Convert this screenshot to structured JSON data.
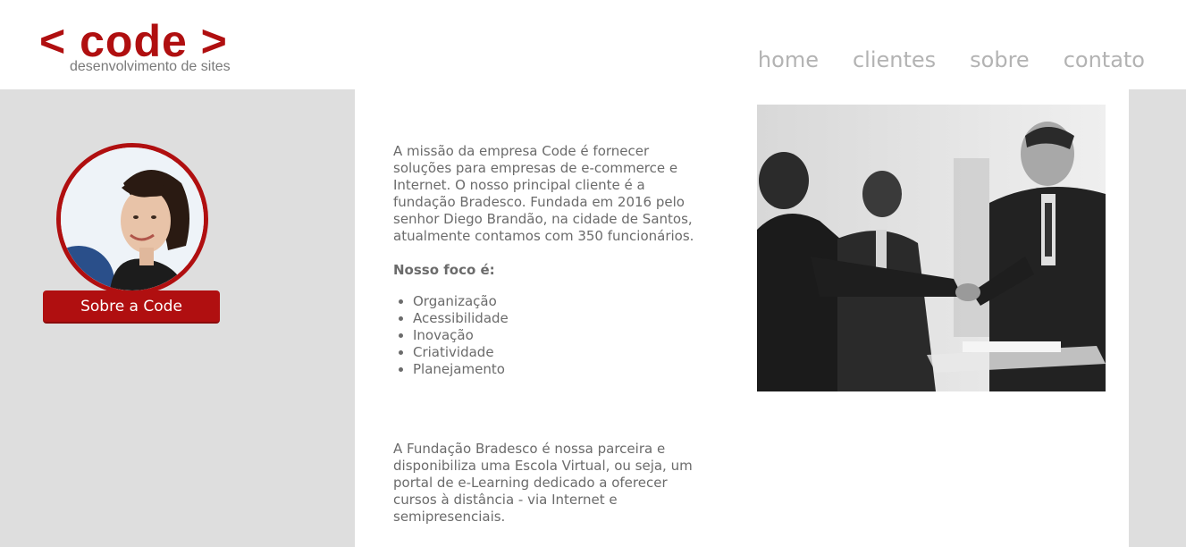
{
  "header": {
    "logo_main": "< code >",
    "logo_sub": "desenvolvimento de sites",
    "nav": [
      {
        "label": "home"
      },
      {
        "label": "clientes"
      },
      {
        "label": "sobre"
      },
      {
        "label": "contato"
      }
    ]
  },
  "sidebar": {
    "button_label": "Sobre a Code"
  },
  "main": {
    "intro": "A missão da empresa Code é fornecer soluções para empresas de e-commerce e Internet. O nosso principal cliente é a fundação Bradesco. Fundada em 2016 pelo senhor Diego Brandão, na cidade de Santos, atualmente contamos com 350 funcionários.",
    "focus_title": "Nosso foco é:",
    "focus_items": [
      "Organização",
      "Acessibilidade",
      "Inovação",
      "Criatividade",
      "Planejamento"
    ],
    "partner_text": "A Fundação Bradesco é nossa parceira e disponibiliza uma Escola Virtual, ou seja, um portal de e-Learning dedicado a oferecer cursos à distância - via Internet e semipresenciais."
  },
  "colors": {
    "brand_red": "#b00f10",
    "side_gray": "#dedede",
    "nav_gray": "#b3b3b3",
    "text_gray": "#6b6b6b"
  }
}
